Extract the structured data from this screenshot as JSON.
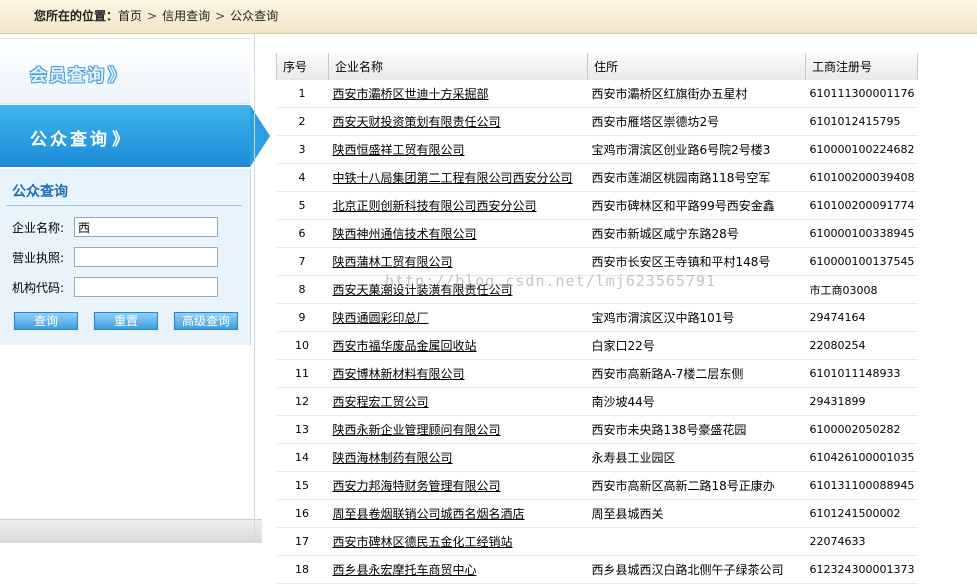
{
  "breadcrumb": {
    "label": "您所在的位置：",
    "items": [
      "首页",
      "信用查询",
      "公众查询"
    ],
    "separator": ">"
  },
  "sidebar": {
    "member_tab": "会员查询",
    "public_tab": "公众查询",
    "chevron": "》"
  },
  "form": {
    "title": "公众查询",
    "company_label": "企业名称:",
    "company_value": "西",
    "license_label": "营业执照:",
    "license_value": "",
    "org_label": "机构代码:",
    "org_value": "",
    "query_button": "查询",
    "reset_button": "重置",
    "advanced_button": "高级查询"
  },
  "table": {
    "headers": [
      "序号",
      "企业名称",
      "住所",
      "工商注册号"
    ],
    "rows": [
      [
        "1",
        "西安市灞桥区世迪十方采掘部",
        "西安市灞桥区红旗街办五星村",
        "610111300001176"
      ],
      [
        "2",
        "西安天财投资策划有限责任公司",
        "西安市雁塔区崇德坊2号",
        "6101012415795"
      ],
      [
        "3",
        "陕西恒盛祥工贸有限公司",
        "宝鸡市渭滨区创业路6号院2号楼3",
        "610000100224682"
      ],
      [
        "4",
        "中铁十八局集团第二工程有限公司西安分公司",
        "西安市莲湖区桃园南路118号空军",
        "610100200039408"
      ],
      [
        "5",
        "北京正则创新科技有限公司西安分公司",
        "西安市碑林区和平路99号西安金鑫",
        "610100200091774"
      ],
      [
        "6",
        "陕西神州通信技术有限公司",
        "西安市新城区咸宁东路28号",
        "610000100338945"
      ],
      [
        "7",
        "陕西蒲林工贸有限公司",
        "西安市长安区王寺镇和平村148号",
        "610000100137545"
      ],
      [
        "8",
        "西安天菓潮设计装潢有限责任公司",
        "",
        "市工商03008"
      ],
      [
        "9",
        "陕西通圆彩印总厂",
        "宝鸡市渭滨区汉中路101号",
        "29474164"
      ],
      [
        "10",
        "西安市福华废品金属回收站",
        "白家口22号",
        "22080254"
      ],
      [
        "11",
        "西安博林新材料有限公司",
        "西安市高新路A-7楼二层东侧",
        "6101011148933"
      ],
      [
        "12",
        "西安程宏工贸公司",
        "南沙坡44号",
        "29431899"
      ],
      [
        "13",
        "陕西永新企业管理顾问有限公司",
        "西安市未央路138号豪盛花园",
        "6100002050282"
      ],
      [
        "14",
        "陕西海林制药有限公司",
        "永寿县工业园区",
        "610426100001035"
      ],
      [
        "15",
        "西安力邦海特财务管理有限公司",
        "西安市高新区高新二路18号正康办",
        "610131100088945"
      ],
      [
        "16",
        "周至县卷烟联销公司城西名烟名酒店",
        "周至县城西关",
        "6101241500002"
      ],
      [
        "17",
        "西安市碑林区德民五金化工经销站",
        "",
        "22074633"
      ],
      [
        "18",
        "西乡县永宏摩托车商贸中心",
        "西乡县城西汉白路北侧午子绿茶公司",
        "612324300001373"
      ]
    ]
  },
  "watermark": "http://blog.csdn.net/lmj623565791"
}
